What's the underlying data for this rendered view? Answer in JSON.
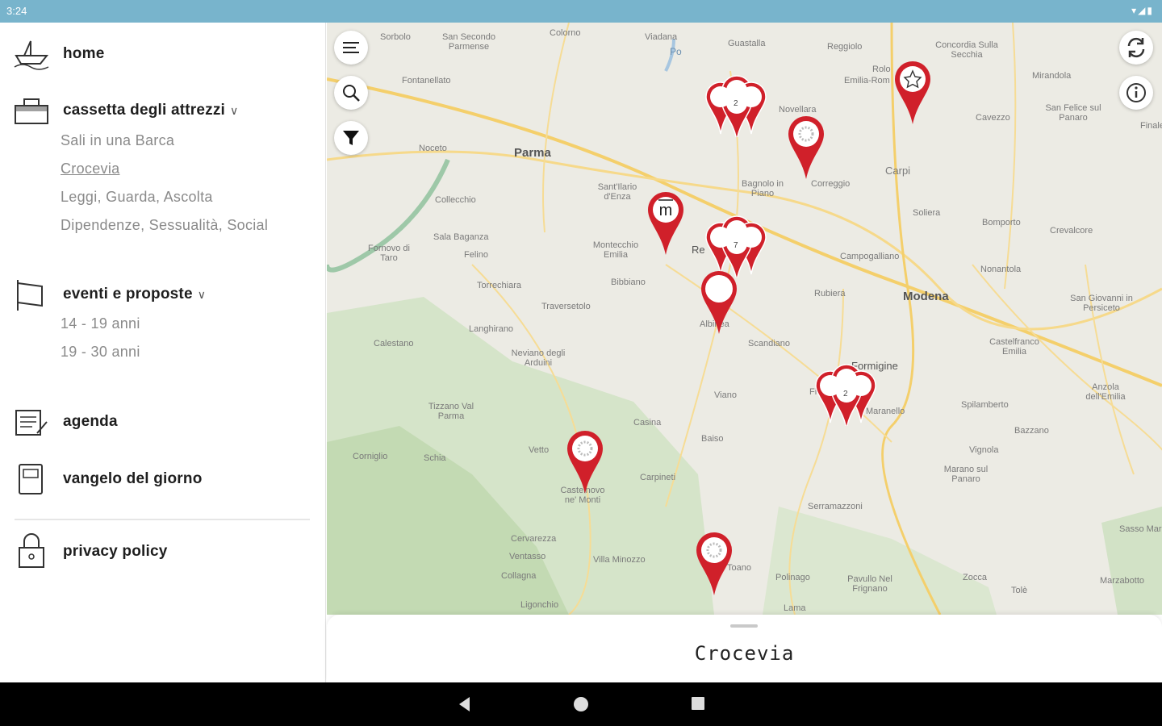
{
  "status": {
    "time": "3:24"
  },
  "drawer": {
    "items": [
      {
        "label": "home",
        "icon": "boat-icon"
      },
      {
        "label": "cassetta degli attrezzi",
        "icon": "toolbox-icon",
        "expandable": true,
        "sub": [
          "Sali in una Barca",
          "Crocevia",
          "Leggi, Guarda, Ascolta",
          "Dipendenze, Sessualità, Social"
        ]
      },
      {
        "label": "eventi e proposte",
        "icon": "flag-icon",
        "expandable": true,
        "sub": [
          "14 - 19 anni",
          "19 - 30 anni"
        ]
      },
      {
        "label": "agenda",
        "icon": "agenda-icon"
      },
      {
        "label": "vangelo del giorno",
        "icon": "book-icon"
      },
      {
        "label": "privacy policy",
        "icon": "lock-icon"
      }
    ],
    "selected_sub": "Crocevia"
  },
  "map": {
    "places": [
      "Sorbolo",
      "San Secondo Parmense",
      "Colorno",
      "Viadana",
      "Po",
      "Guastalla",
      "Reggiolo",
      "Concordia Sulla Secchia",
      "Mirandola",
      "Rolo",
      "Emilia-Rom",
      "Fontanellato",
      "Novellara",
      "San Felice sul Panaro",
      "Cavezzo",
      "Finale",
      "Noceto",
      "Parma",
      "Sant'Ilario d'Enza",
      "Bagnolo in Piano",
      "Correggio",
      "Carpi",
      "Collecchio",
      "Soliera",
      "Bomporto",
      "Crevalcore",
      "Sala Baganza",
      "Felino",
      "Fornovo di Taro",
      "Montecchio Emilia",
      "Re",
      "Campogalliano",
      "Nonantola",
      "Bibbiano",
      "Torrechiara",
      "Rubiera",
      "Modena",
      "San Giovanni in Persiceto",
      "Traversetolo",
      "Albinea",
      "Langhirano",
      "Scandiano",
      "Calestano",
      "Neviano degli Arduini",
      "Fiorano",
      "Formigine",
      "Castelfranco Emilia",
      "Viano",
      "Maranello",
      "Tizzano Val Parma",
      "Spilamberto",
      "Anzola dell'Emilia",
      "Casina",
      "Baiso",
      "Bazzano",
      "Corniglio",
      "Vetto",
      "Vignola",
      "Schia",
      "Castelnovo ne' Monti",
      "Carpineti",
      "Marano sul Panaro",
      "Serramazzoni",
      "Sasso Marconi",
      "Cervarezza",
      "Ventasso",
      "Villa Minozzo",
      "Toano",
      "Polinago",
      "Pavullo Nel Frignano",
      "Zocca",
      "Tolè",
      "Marzabotto",
      "Collagna",
      "Ligonchio",
      "Lama"
    ],
    "clusters": [
      "2",
      "7",
      "2"
    ],
    "marker_m": "m",
    "accent_color": "#d0202a"
  },
  "sheet": {
    "title": "Crocevia"
  }
}
